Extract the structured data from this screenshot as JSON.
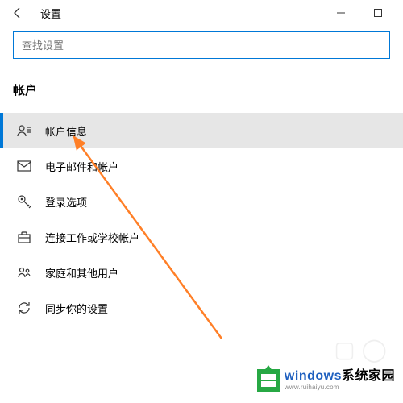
{
  "titlebar": {
    "title": "设置"
  },
  "search": {
    "placeholder": "查找设置"
  },
  "section": {
    "heading": "帐户"
  },
  "menu": {
    "items": [
      {
        "label": "帐户信息",
        "selected": true
      },
      {
        "label": "电子邮件和帐户",
        "selected": false
      },
      {
        "label": "登录选项",
        "selected": false
      },
      {
        "label": "连接工作或学校帐户",
        "selected": false
      },
      {
        "label": "家庭和其他用户",
        "selected": false
      },
      {
        "label": "同步你的设置",
        "selected": false
      }
    ]
  },
  "watermark": {
    "brand_a": "windows",
    "brand_b": "系统家园",
    "url": "www.ruihaiyu.com"
  }
}
